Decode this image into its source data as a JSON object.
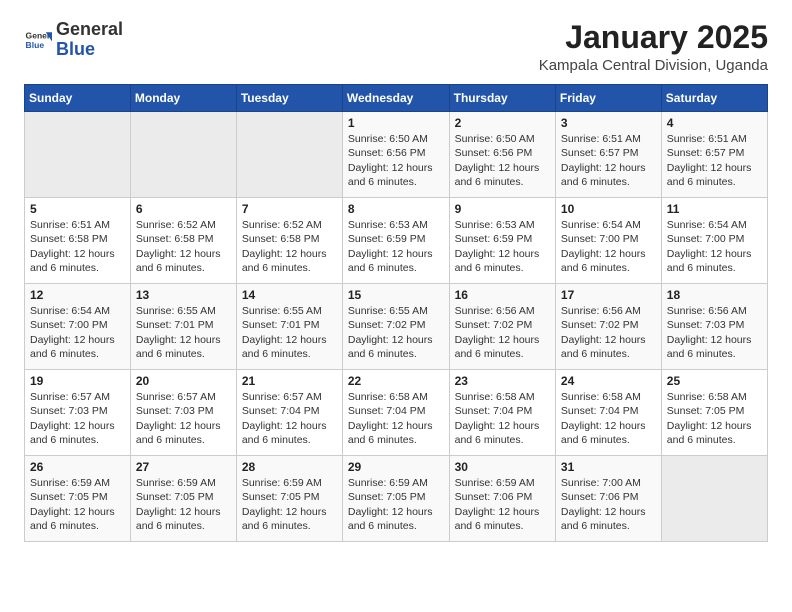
{
  "logo": {
    "general": "General",
    "blue": "Blue"
  },
  "title": "January 2025",
  "subtitle": "Kampala Central Division, Uganda",
  "weekdays": [
    "Sunday",
    "Monday",
    "Tuesday",
    "Wednesday",
    "Thursday",
    "Friday",
    "Saturday"
  ],
  "weeks": [
    [
      {
        "day": "",
        "info": ""
      },
      {
        "day": "",
        "info": ""
      },
      {
        "day": "",
        "info": ""
      },
      {
        "day": "1",
        "info": "Sunrise: 6:50 AM\nSunset: 6:56 PM\nDaylight: 12 hours and 6 minutes."
      },
      {
        "day": "2",
        "info": "Sunrise: 6:50 AM\nSunset: 6:56 PM\nDaylight: 12 hours and 6 minutes."
      },
      {
        "day": "3",
        "info": "Sunrise: 6:51 AM\nSunset: 6:57 PM\nDaylight: 12 hours and 6 minutes."
      },
      {
        "day": "4",
        "info": "Sunrise: 6:51 AM\nSunset: 6:57 PM\nDaylight: 12 hours and 6 minutes."
      }
    ],
    [
      {
        "day": "5",
        "info": "Sunrise: 6:51 AM\nSunset: 6:58 PM\nDaylight: 12 hours and 6 minutes."
      },
      {
        "day": "6",
        "info": "Sunrise: 6:52 AM\nSunset: 6:58 PM\nDaylight: 12 hours and 6 minutes."
      },
      {
        "day": "7",
        "info": "Sunrise: 6:52 AM\nSunset: 6:58 PM\nDaylight: 12 hours and 6 minutes."
      },
      {
        "day": "8",
        "info": "Sunrise: 6:53 AM\nSunset: 6:59 PM\nDaylight: 12 hours and 6 minutes."
      },
      {
        "day": "9",
        "info": "Sunrise: 6:53 AM\nSunset: 6:59 PM\nDaylight: 12 hours and 6 minutes."
      },
      {
        "day": "10",
        "info": "Sunrise: 6:54 AM\nSunset: 7:00 PM\nDaylight: 12 hours and 6 minutes."
      },
      {
        "day": "11",
        "info": "Sunrise: 6:54 AM\nSunset: 7:00 PM\nDaylight: 12 hours and 6 minutes."
      }
    ],
    [
      {
        "day": "12",
        "info": "Sunrise: 6:54 AM\nSunset: 7:00 PM\nDaylight: 12 hours and 6 minutes."
      },
      {
        "day": "13",
        "info": "Sunrise: 6:55 AM\nSunset: 7:01 PM\nDaylight: 12 hours and 6 minutes."
      },
      {
        "day": "14",
        "info": "Sunrise: 6:55 AM\nSunset: 7:01 PM\nDaylight: 12 hours and 6 minutes."
      },
      {
        "day": "15",
        "info": "Sunrise: 6:55 AM\nSunset: 7:02 PM\nDaylight: 12 hours and 6 minutes."
      },
      {
        "day": "16",
        "info": "Sunrise: 6:56 AM\nSunset: 7:02 PM\nDaylight: 12 hours and 6 minutes."
      },
      {
        "day": "17",
        "info": "Sunrise: 6:56 AM\nSunset: 7:02 PM\nDaylight: 12 hours and 6 minutes."
      },
      {
        "day": "18",
        "info": "Sunrise: 6:56 AM\nSunset: 7:03 PM\nDaylight: 12 hours and 6 minutes."
      }
    ],
    [
      {
        "day": "19",
        "info": "Sunrise: 6:57 AM\nSunset: 7:03 PM\nDaylight: 12 hours and 6 minutes."
      },
      {
        "day": "20",
        "info": "Sunrise: 6:57 AM\nSunset: 7:03 PM\nDaylight: 12 hours and 6 minutes."
      },
      {
        "day": "21",
        "info": "Sunrise: 6:57 AM\nSunset: 7:04 PM\nDaylight: 12 hours and 6 minutes."
      },
      {
        "day": "22",
        "info": "Sunrise: 6:58 AM\nSunset: 7:04 PM\nDaylight: 12 hours and 6 minutes."
      },
      {
        "day": "23",
        "info": "Sunrise: 6:58 AM\nSunset: 7:04 PM\nDaylight: 12 hours and 6 minutes."
      },
      {
        "day": "24",
        "info": "Sunrise: 6:58 AM\nSunset: 7:04 PM\nDaylight: 12 hours and 6 minutes."
      },
      {
        "day": "25",
        "info": "Sunrise: 6:58 AM\nSunset: 7:05 PM\nDaylight: 12 hours and 6 minutes."
      }
    ],
    [
      {
        "day": "26",
        "info": "Sunrise: 6:59 AM\nSunset: 7:05 PM\nDaylight: 12 hours and 6 minutes."
      },
      {
        "day": "27",
        "info": "Sunrise: 6:59 AM\nSunset: 7:05 PM\nDaylight: 12 hours and 6 minutes."
      },
      {
        "day": "28",
        "info": "Sunrise: 6:59 AM\nSunset: 7:05 PM\nDaylight: 12 hours and 6 minutes."
      },
      {
        "day": "29",
        "info": "Sunrise: 6:59 AM\nSunset: 7:05 PM\nDaylight: 12 hours and 6 minutes."
      },
      {
        "day": "30",
        "info": "Sunrise: 6:59 AM\nSunset: 7:06 PM\nDaylight: 12 hours and 6 minutes."
      },
      {
        "day": "31",
        "info": "Sunrise: 7:00 AM\nSunset: 7:06 PM\nDaylight: 12 hours and 6 minutes."
      },
      {
        "day": "",
        "info": ""
      }
    ]
  ]
}
